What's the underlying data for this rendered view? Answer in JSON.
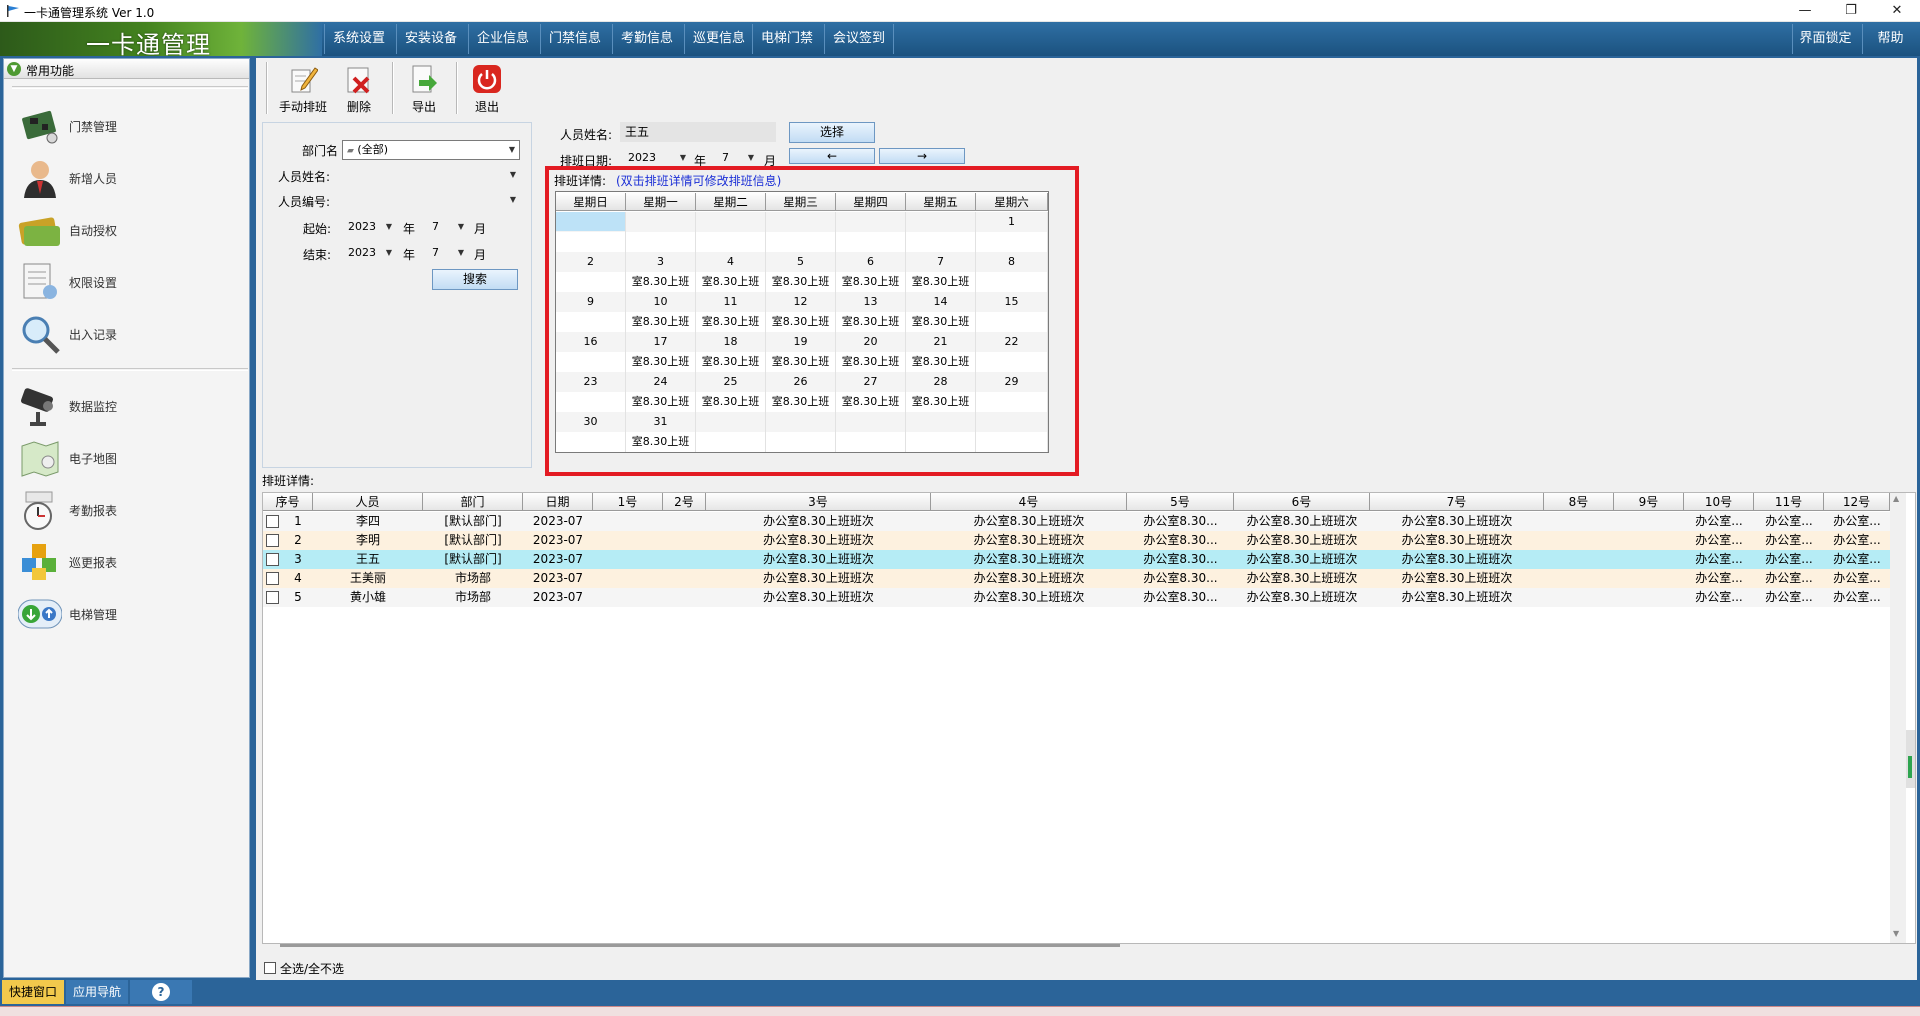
{
  "window": {
    "title": "一卡通管理系统  Ver 1.0",
    "min": "—",
    "restore": "❐",
    "close": "✕"
  },
  "app": {
    "logo_text": "一卡通管理"
  },
  "menu": {
    "items": [
      "系统设置",
      "安装设备",
      "企业信息",
      "门禁信息",
      "考勤信息",
      "巡更信息",
      "电梯门禁",
      "会议签到"
    ],
    "right": [
      "界面锁定",
      "帮助"
    ]
  },
  "sidebar": {
    "header": "常用功能",
    "items": [
      "门禁管理",
      "新增人员",
      "自动授权",
      "权限设置",
      "出入记录",
      "数据监控",
      "电子地图",
      "考勤报表",
      "巡更报表",
      "电梯管理"
    ],
    "tabs": [
      "快捷窗口",
      "应用导航",
      "?"
    ]
  },
  "toolbar": {
    "manual": "手动排班",
    "delete": "删除",
    "export": "导出",
    "exit": "退出"
  },
  "search": {
    "dept_label": "部门名",
    "dept_value": "(全部)",
    "name_label": "人员姓名:",
    "id_label": "人员编号:",
    "start_label": "起始:",
    "end_label": "结束:",
    "start_year": "2023",
    "start_month": "7",
    "end_year": "2023",
    "end_month": "7",
    "year_unit": "年",
    "month_unit": "月",
    "search_btn": "搜索"
  },
  "person": {
    "name_label": "人员姓名:",
    "name_value": "王五",
    "select_btn": "选择",
    "date_label": "排班日期:",
    "year": "2023",
    "month": "7",
    "year_unit": "年",
    "month_unit": "月",
    "prev_btn": "←",
    "next_btn": "→"
  },
  "calendar": {
    "title": "排班详情:",
    "hint": "(双击排班详情可修改排班信息)",
    "weekdays": [
      "星期日",
      "星期一",
      "星期二",
      "星期三",
      "星期四",
      "星期五",
      "星期六"
    ],
    "weeks": [
      {
        "days": [
          "",
          "",
          "",
          "",
          "",
          "",
          "1"
        ],
        "shifts": [
          "",
          "",
          "",
          "",
          "",
          "",
          ""
        ]
      },
      {
        "days": [
          "2",
          "3",
          "4",
          "5",
          "6",
          "7",
          "8"
        ],
        "shifts": [
          "",
          "室8.30上班",
          "室8.30上班",
          "室8.30上班",
          "室8.30上班",
          "室8.30上班",
          ""
        ]
      },
      {
        "days": [
          "9",
          "10",
          "11",
          "12",
          "13",
          "14",
          "15"
        ],
        "shifts": [
          "",
          "室8.30上班",
          "室8.30上班",
          "室8.30上班",
          "室8.30上班",
          "室8.30上班",
          ""
        ]
      },
      {
        "days": [
          "16",
          "17",
          "18",
          "19",
          "20",
          "21",
          "22"
        ],
        "shifts": [
          "",
          "室8.30上班",
          "室8.30上班",
          "室8.30上班",
          "室8.30上班",
          "室8.30上班",
          ""
        ]
      },
      {
        "days": [
          "23",
          "24",
          "25",
          "26",
          "27",
          "28",
          "29"
        ],
        "shifts": [
          "",
          "室8.30上班",
          "室8.30上班",
          "室8.30上班",
          "室8.30上班",
          "室8.30上班",
          ""
        ]
      },
      {
        "days": [
          "30",
          "31",
          "",
          "",
          "",
          "",
          ""
        ],
        "shifts": [
          "",
          "室8.30上班",
          "",
          "",
          "",
          "",
          ""
        ]
      }
    ]
  },
  "list": {
    "label": "排班详情:",
    "columns": [
      "序号",
      "人员",
      "部门",
      "日期",
      "1号",
      "2号",
      "3号",
      "4号",
      "5号",
      "6号",
      "7号",
      "8号",
      "9号",
      "10号",
      "11号",
      "12号"
    ],
    "rows": [
      {
        "no": "1",
        "person": "李四",
        "dept": "[默认部门]",
        "date": "2023-07",
        "d3": "办公室8.30上班班次",
        "d4": "办公室8.30上班班次",
        "d5": "办公室8.30...",
        "d6": "办公室8.30上班班次",
        "d7": "办公室8.30上班班次",
        "d10": "办公室...",
        "d11": "办公室...",
        "d12": "办公室..."
      },
      {
        "no": "2",
        "person": "李明",
        "dept": "[默认部门]",
        "date": "2023-07",
        "d3": "办公室8.30上班班次",
        "d4": "办公室8.30上班班次",
        "d5": "办公室8.30...",
        "d6": "办公室8.30上班班次",
        "d7": "办公室8.30上班班次",
        "d10": "办公室...",
        "d11": "办公室...",
        "d12": "办公室..."
      },
      {
        "no": "3",
        "person": "王五",
        "dept": "[默认部门]",
        "date": "2023-07",
        "d3": "办公室8.30上班班次",
        "d4": "办公室8.30上班班次",
        "d5": "办公室8.30...",
        "d6": "办公室8.30上班班次",
        "d7": "办公室8.30上班班次",
        "d10": "办公室...",
        "d11": "办公室...",
        "d12": "办公室..."
      },
      {
        "no": "4",
        "person": "王美丽",
        "dept": "市场部",
        "date": "2023-07",
        "d3": "办公室8.30上班班次",
        "d4": "办公室8.30上班班次",
        "d5": "办公室8.30...",
        "d6": "办公室8.30上班班次",
        "d7": "办公室8.30上班班次",
        "d10": "办公室...",
        "d11": "办公室...",
        "d12": "办公室..."
      },
      {
        "no": "5",
        "person": "黄小雄",
        "dept": "市场部",
        "date": "2023-07",
        "d3": "办公室8.30上班班次",
        "d4": "办公室8.30上班班次",
        "d5": "办公室8.30...",
        "d6": "办公室8.30上班班次",
        "d7": "办公室8.30上班班次",
        "d10": "办公室...",
        "d11": "办公室...",
        "d12": "办公室..."
      }
    ],
    "select_all": "全选/全不选"
  },
  "colors": {
    "accent": "#2b6499",
    "highlight": "#e31b23",
    "hint": "#1b2fd6",
    "selected_row": "#b5ecf5"
  }
}
